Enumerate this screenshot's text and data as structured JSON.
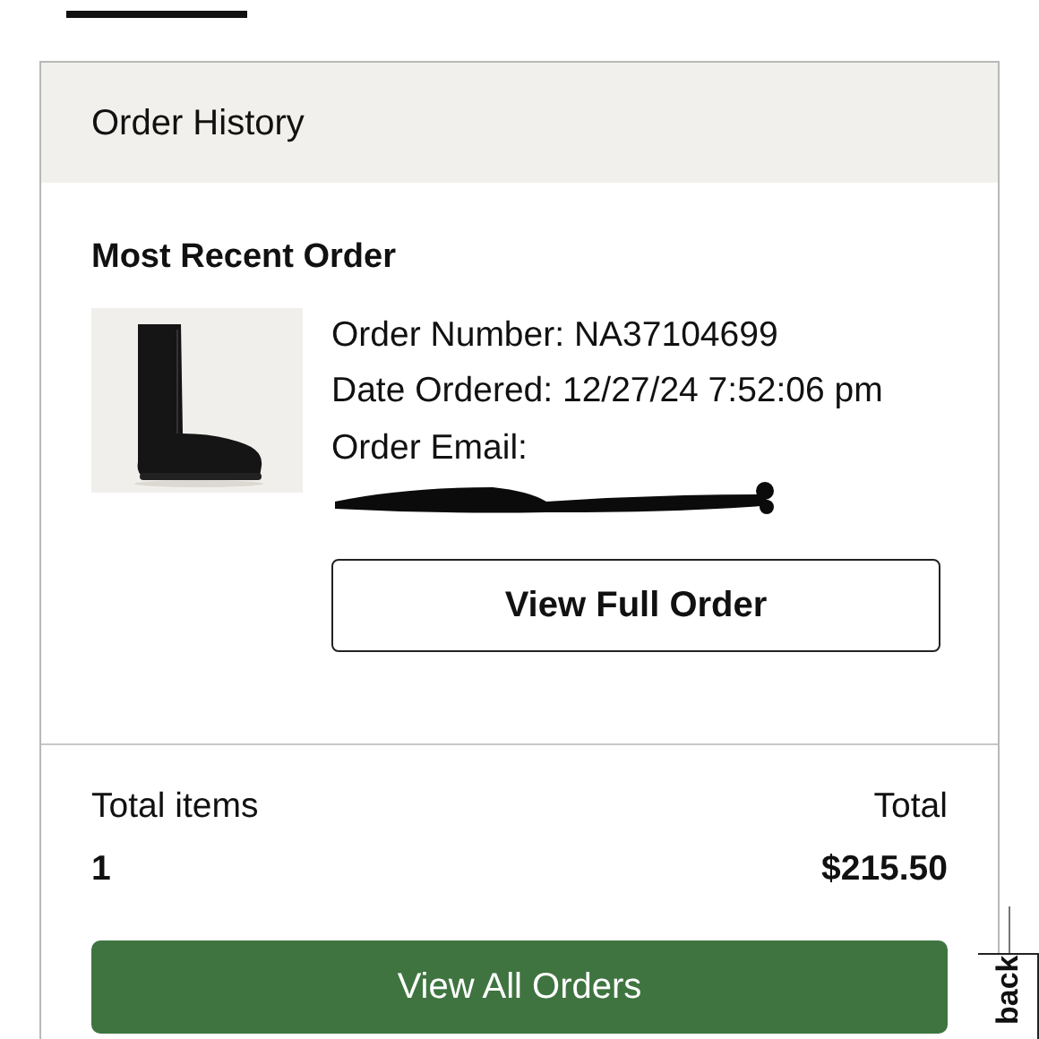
{
  "card": {
    "title": "Order History"
  },
  "recent_order": {
    "heading": "Most Recent Order",
    "details": [
      "Order Number: NA37104699",
      "Date Ordered: 12/27/24 7:52:06 pm",
      "Order Email:"
    ],
    "email_redacted": true,
    "button": "View Full Order"
  },
  "summary": {
    "items_label": "Total items",
    "items_value": "1",
    "total_label": "Total",
    "total_value": "$215.50"
  },
  "primary_button": "View All Orders",
  "side_tab": "back"
}
